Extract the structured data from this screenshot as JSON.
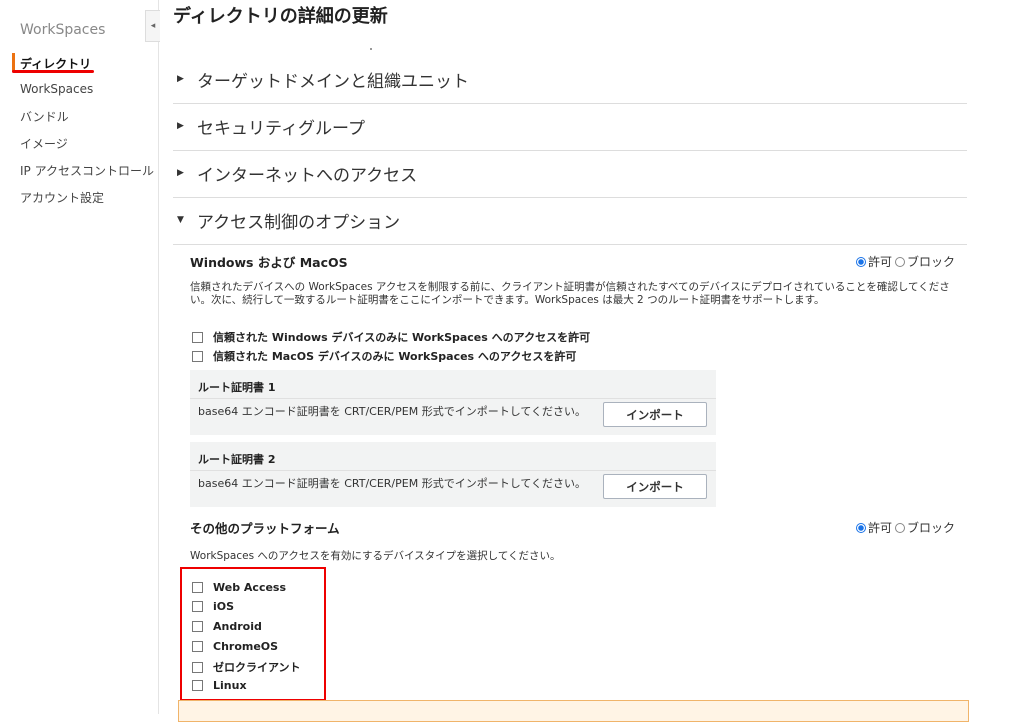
{
  "sidebar": {
    "title": "WorkSpaces",
    "collapse_icon": "◂",
    "items": [
      {
        "label": "ディレクトリ",
        "active": true
      },
      {
        "label": "WorkSpaces"
      },
      {
        "label": "バンドル"
      },
      {
        "label": "イメージ"
      },
      {
        "label": "IP アクセスコントロール"
      },
      {
        "label": "アカウント設定"
      }
    ]
  },
  "page": {
    "title": "ディレクトリの詳細の更新"
  },
  "sections": [
    {
      "label": "ターゲットドメインと組織ユニット",
      "expanded": false
    },
    {
      "label": "セキュリティグループ",
      "expanded": false
    },
    {
      "label": "インターネットへのアクセス",
      "expanded": false
    },
    {
      "label": "アクセス制御のオプション",
      "expanded": true
    }
  ],
  "icons": {
    "collapsed": "▶",
    "expanded": "▼"
  },
  "windows_macos": {
    "title": "Windows および MacOS",
    "radio_allow": "許可",
    "radio_block": "ブロック",
    "selected": "許可",
    "description": "信頼されたデバイスへの WorkSpaces アクセスを制限する前に、クライアント証明書が信頼されたすべてのデバイスにデプロイされていることを確認してください。次に、続行して一致するルート証明書をここにインポートできます。WorkSpaces は最大 2 つのルート証明書をサポートします。",
    "checkboxes": [
      "信頼された Windows デバイスのみに WorkSpaces へのアクセスを許可",
      "信頼された MacOS デバイスのみに WorkSpaces へのアクセスを許可"
    ],
    "certificates": [
      {
        "title": "ルート証明書 1",
        "description": "base64 エンコード証明書を CRT/CER/PEM 形式でインポートしてください。",
        "button": "インポート"
      },
      {
        "title": "ルート証明書 2",
        "description": "base64 エンコード証明書を CRT/CER/PEM 形式でインポートしてください。",
        "button": "インポート"
      }
    ]
  },
  "other_platforms": {
    "title": "その他のプラットフォーム",
    "radio_allow": "許可",
    "radio_block": "ブロック",
    "selected": "許可",
    "description": "WorkSpaces へのアクセスを有効にするデバイスタイプを選択してください。",
    "platforms": [
      "Web Access",
      "iOS",
      "Android",
      "ChromeOS",
      "ゼロクライアント",
      "Linux"
    ]
  },
  "colors": {
    "accent": "#ec7211",
    "highlight": "#ee0000",
    "radio": "#1a73e8"
  }
}
